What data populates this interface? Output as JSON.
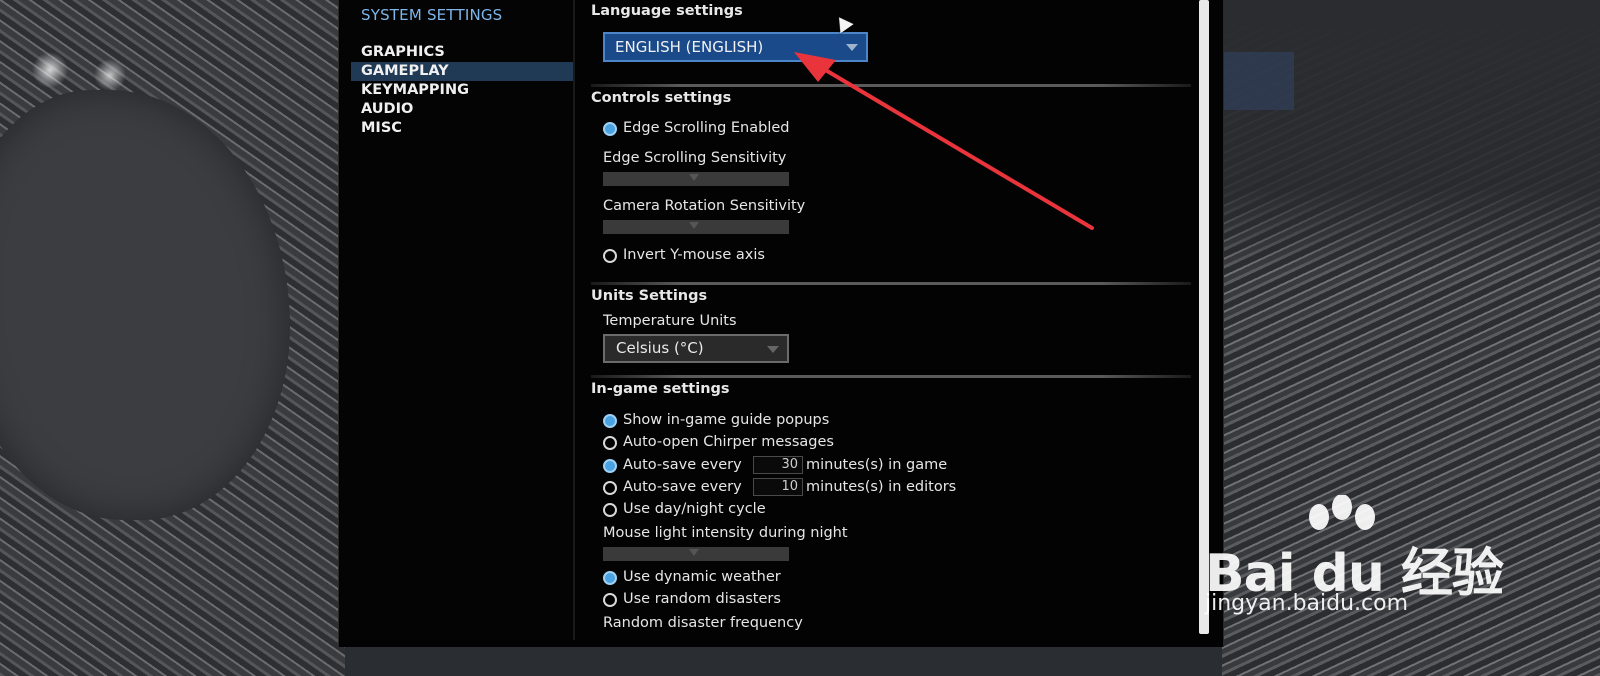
{
  "sidebar": {
    "title": "SYSTEM SETTINGS",
    "items": [
      {
        "label": "GRAPHICS"
      },
      {
        "label": "GAMEPLAY"
      },
      {
        "label": "KEYMAPPING"
      },
      {
        "label": "AUDIO"
      },
      {
        "label": "MISC"
      }
    ],
    "active_item": "GAMEPLAY"
  },
  "language": {
    "title": "Language settings",
    "selected": "ENGLISH (ENGLISH)"
  },
  "controls": {
    "title": "Controls settings",
    "edge_scrolling_label": "Edge Scrolling Enabled",
    "edge_scrolling_checked": true,
    "edge_sensitivity_label": "Edge Scrolling Sensitivity",
    "camera_rotation_label": "Camera Rotation Sensitivity",
    "invert_y_label": "Invert Y-mouse axis",
    "invert_y_checked": false
  },
  "units": {
    "title": "Units Settings",
    "temperature_label": "Temperature Units",
    "temperature_value": "Celsius (°C)"
  },
  "ingame": {
    "title": "In-game settings",
    "guide_popups_label": "Show in-game guide popups",
    "guide_popups_checked": true,
    "chirper_label": "Auto-open Chirper messages",
    "chirper_checked": false,
    "autosave_game_label": "Auto-save every",
    "autosave_game_value": "30",
    "autosave_game_suffix": "minutes(s) in game",
    "autosave_game_checked": true,
    "autosave_editor_label": "Auto-save every",
    "autosave_editor_value": "10",
    "autosave_editor_suffix": "minutes(s) in editors",
    "autosave_editor_checked": false,
    "day_night_label": "Use day/night cycle",
    "day_night_checked": false,
    "mouse_light_label": "Mouse light intensity during night",
    "dynamic_weather_label": "Use dynamic weather",
    "dynamic_weather_checked": true,
    "random_disasters_label": "Use random disasters",
    "random_disasters_checked": false,
    "disaster_frequency_label": "Random disaster frequency"
  },
  "watermark": {
    "brand": "Bai du 经验",
    "url": "jingyan.baidu.com"
  },
  "colors": {
    "accent": "#4aa3e0",
    "dropdown_active": "#1b4a8a",
    "sidebar_title": "#7fb6ea",
    "annotation_arrow": "#e8343a"
  }
}
